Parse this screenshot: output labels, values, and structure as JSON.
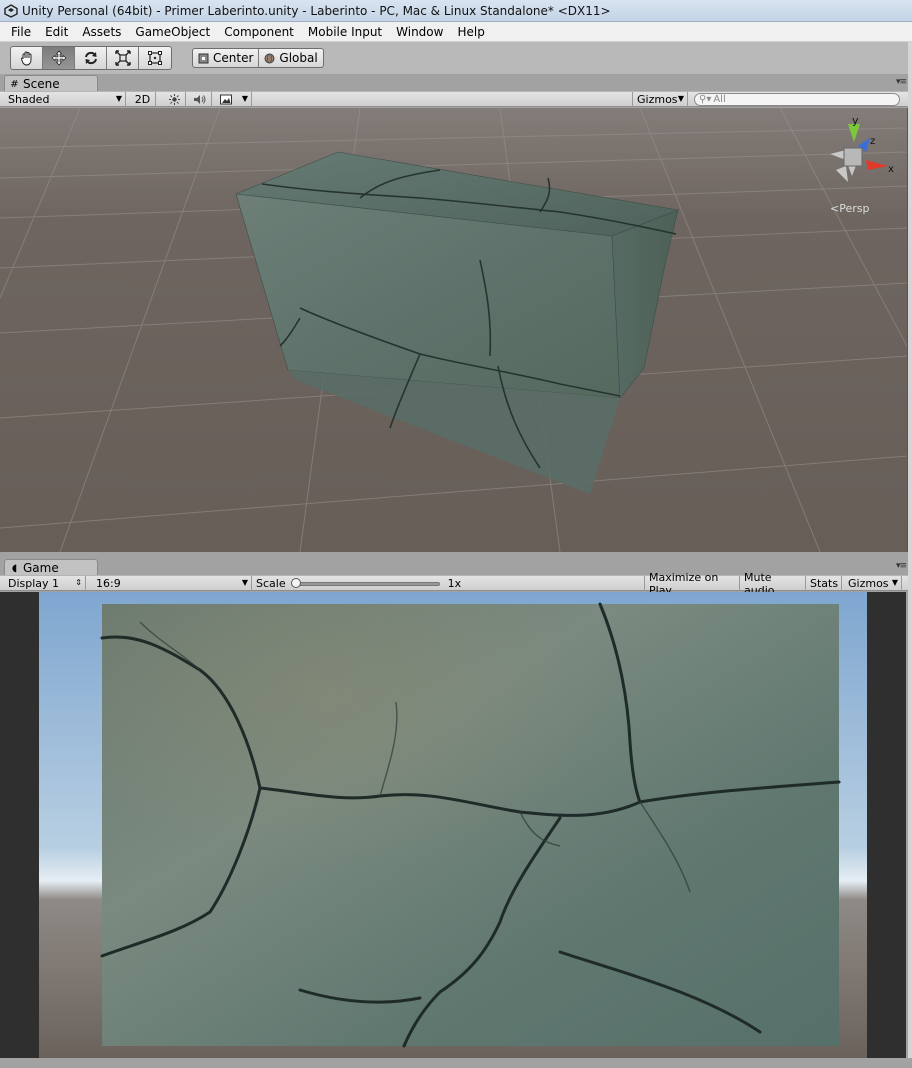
{
  "window": {
    "title": "Unity Personal (64bit) - Primer Laberinto.unity - Laberinto - PC, Mac & Linux Standalone* <DX11>"
  },
  "menu": [
    "File",
    "Edit",
    "Assets",
    "GameObject",
    "Component",
    "Mobile Input",
    "Window",
    "Help"
  ],
  "toolbar": {
    "tools": [
      "hand-tool-icon",
      "move-tool-icon",
      "rotate-tool-icon",
      "scale-tool-icon",
      "rect-tool-icon"
    ],
    "active_tool": "move-tool-icon",
    "pivot_mode": "Center",
    "pivot_space": "Global"
  },
  "scene": {
    "tab_label": "Scene",
    "draw_mode": "Shaded",
    "mode_2d": "2D",
    "gizmos": "Gizmos",
    "search_placeholder": "All",
    "projection": "Persp",
    "axis_labels": {
      "x": "x",
      "y": "y",
      "z": "z"
    }
  },
  "game": {
    "tab_label": "Game",
    "display": "Display 1",
    "aspect": "16:9",
    "scale_label": "Scale",
    "scale_value": "1x",
    "maximize": "Maximize on Play",
    "mute": "Mute audio",
    "stats": "Stats",
    "gizmos": "Gizmos"
  },
  "colors": {
    "scene_background": "#6b625c",
    "concrete": "#5f756d",
    "sky": "#8fb2d6",
    "axis_x": "#e03a2a",
    "axis_y": "#7cc83a",
    "axis_z": "#3a6fd8"
  }
}
